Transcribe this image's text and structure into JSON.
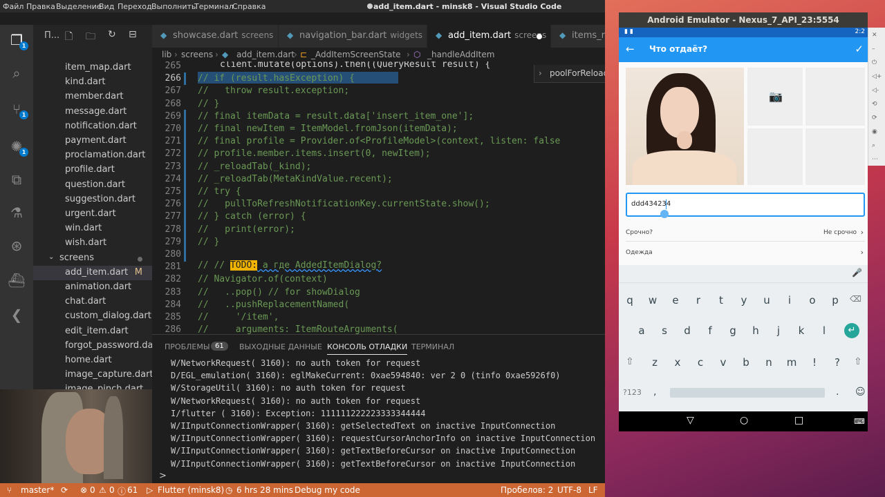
{
  "window": {
    "title": "add_item.dart - minsk8 - Visual Studio Code",
    "menus": [
      "Файл",
      "Правка",
      "Выделение",
      "Вид",
      "Переход",
      "Выполнить",
      "Терминал",
      "Справка"
    ]
  },
  "activity": {
    "badges": [
      "1",
      "1",
      "1"
    ]
  },
  "explorer": {
    "header": "П...",
    "files_top": [
      "item_map.dart",
      "kind.dart",
      "member.dart",
      "message.dart",
      "notification.dart",
      "payment.dart",
      "proclamation.dart",
      "profile.dart",
      "question.dart",
      "suggestion.dart",
      "urgent.dart",
      "win.dart",
      "wish.dart"
    ],
    "folder": "screens",
    "selected_file": "add_item.dart",
    "selected_marker": "M",
    "files_bottom": [
      "animation.dart",
      "chat.dart",
      "custom_dialog.dart",
      "edit_item.dart",
      "forgot_password.dart",
      "home.dart",
      "image_capture.dart",
      "image_pinch.dart"
    ]
  },
  "tabs": [
    {
      "label": "showcase.dart",
      "folder": "screens"
    },
    {
      "label": "navigation_bar.dart",
      "folder": "widgets"
    },
    {
      "label": "add_item.dart",
      "folder": "screens"
    },
    {
      "label": "items_re"
    }
  ],
  "breadcrumb": [
    "lib",
    "screens",
    "add_item.dart",
    "_AddItemScreenState",
    "_handleAddItem"
  ],
  "peek": "poolForReload",
  "editor": {
    "top_fragment": "client.mutate(options).then((QueryResult result) {",
    "lines": [
      {
        "n": "265",
        "t": ""
      },
      {
        "n": "266",
        "t": "// if (result.hasException) {"
      },
      {
        "n": "267",
        "t": "//   throw result.exception;"
      },
      {
        "n": "268",
        "t": "// }"
      },
      {
        "n": "269",
        "t": "// final itemData = result.data['insert_item_one'];"
      },
      {
        "n": "270",
        "t": "// final newItem = ItemModel.fromJson(itemData);"
      },
      {
        "n": "271",
        "t": "// final profile = Provider.of<ProfileModel>(context, listen: false"
      },
      {
        "n": "272",
        "t": "// profile.member.items.insert(0, newItem);"
      },
      {
        "n": "273",
        "t": "// _reloadTab(_kind);"
      },
      {
        "n": "274",
        "t": "// _reloadTab(MetaKindValue.recent);"
      },
      {
        "n": "275",
        "t": "// try {"
      },
      {
        "n": "276",
        "t": "//   pullToRefreshNotificationKey.currentState.show();"
      },
      {
        "n": "277",
        "t": "// } catch (error) {"
      },
      {
        "n": "278",
        "t": "//   print(error);"
      },
      {
        "n": "279",
        "t": "// }"
      },
      {
        "n": "280",
        "t": ""
      },
      {
        "n": "281",
        "t": ""
      },
      {
        "n": "282",
        "t": "// Navigator.of(context)"
      },
      {
        "n": "283",
        "t": "//   ..pop() // for showDialog"
      },
      {
        "n": "284",
        "t": "//   ..pushReplacementNamed("
      },
      {
        "n": "285",
        "t": "//     '/item',"
      },
      {
        "n": "286",
        "t": "//     arguments: ItemRouteArguments("
      }
    ],
    "todo_prefix": "// // ",
    "todo_tag": "TODO:",
    "todo_rest": " а где AddedItemDialog?"
  },
  "panel": {
    "tabs": [
      "ПРОБЛЕМЫ",
      "ВЫХОДНЫЕ ДАННЫЕ",
      "КОНСОЛЬ ОТЛАДКИ",
      "ТЕРМИНАЛ"
    ],
    "problems_count": "61",
    "logs": [
      "W/NetworkRequest( 3160): no auth token for request",
      "D/EGL_emulation( 3160): eglMakeCurrent: 0xae594840: ver 2 0 (tinfo 0xae5926f0)",
      "W/StorageUtil( 3160): no auth token for request",
      "W/NetworkRequest( 3160): no auth token for request",
      "I/flutter ( 3160): Exception: 111111222223333344444",
      "W/IInputConnectionWrapper( 3160): getSelectedText on inactive InputConnection",
      "W/IInputConnectionWrapper( 3160): requestCursorAnchorInfo on inactive InputConnection",
      "W/IInputConnectionWrapper( 3160): getTextBeforeCursor on inactive InputConnection",
      "W/IInputConnectionWrapper( 3160): getTextBeforeCursor on inactive InputConnection"
    ],
    "prompt": ">"
  },
  "statusbar": {
    "branch": "master*",
    "errors": "0",
    "warnings": "0",
    "info": "61",
    "device": "Flutter (minsk8)",
    "time": "6 hrs 28 mins",
    "mode": "Debug my code",
    "indent": "Пробелов: 2",
    "encoding": "UTF-8",
    "eol": "LF"
  },
  "emulator": {
    "title": "Android Emulator - Nexus_7_API_23:5554",
    "clock": "2:2",
    "app_title": "Что отдаёт?",
    "input_value": "ddd434234",
    "row1_label": "Срочно?",
    "row1_value": "Не срочно",
    "row2_label": "Одежда",
    "keys_row1": [
      "q",
      "w",
      "e",
      "r",
      "t",
      "y",
      "u",
      "i",
      "o",
      "p"
    ],
    "keys_row2": [
      "a",
      "s",
      "d",
      "f",
      "g",
      "h",
      "j",
      "k",
      "l"
    ],
    "keys_row3": [
      "z",
      "x",
      "c",
      "v",
      "b",
      "n",
      "m",
      "!",
      "?"
    ],
    "key_numbers": "?123",
    "key_comma": ",",
    "key_period": ".",
    "key_emoji": "☺"
  }
}
